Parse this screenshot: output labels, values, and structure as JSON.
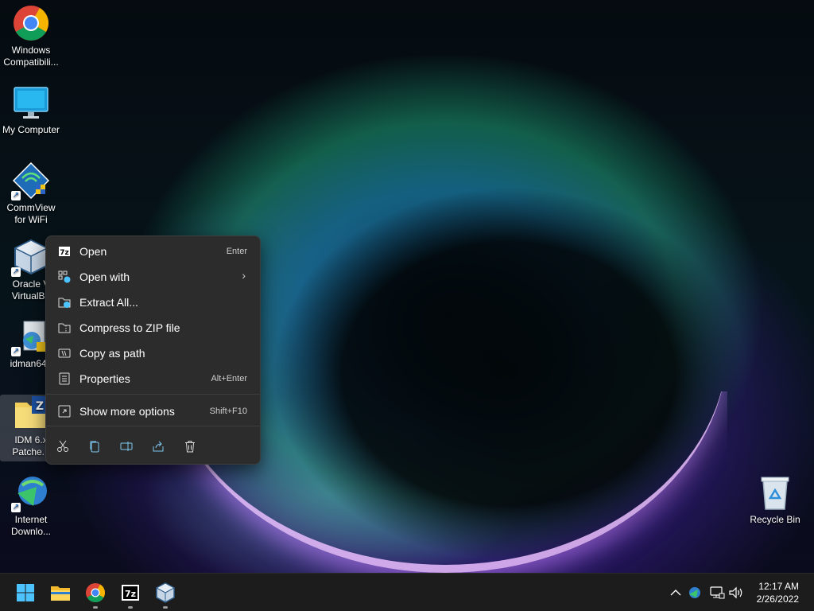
{
  "desktop": {
    "icons": [
      {
        "label": "Windows\nCompatibili..."
      },
      {
        "label": "My Computer"
      },
      {
        "label": "CommView\nfor WiFi"
      },
      {
        "label": "Oracle V\nVirtualBo"
      },
      {
        "label": "idman640"
      },
      {
        "label": "IDM 6.x\nPatche..."
      },
      {
        "label": "Internet\nDownlo..."
      },
      {
        "label": "Recycle Bin"
      }
    ]
  },
  "context_menu": {
    "items": [
      {
        "label": "Open",
        "shortcut": "Enter",
        "icon": "7zip-icon"
      },
      {
        "label": "Open with",
        "shortcut": "",
        "icon": "open-with-icon"
      },
      {
        "label": "Extract All...",
        "shortcut": "",
        "icon": "extract-icon"
      },
      {
        "label": "Compress to ZIP file",
        "shortcut": "",
        "icon": "zip-icon"
      },
      {
        "label": "Copy as path",
        "shortcut": "",
        "icon": "copy-path-icon"
      },
      {
        "label": "Properties",
        "shortcut": "Alt+Enter",
        "icon": "properties-icon"
      }
    ],
    "more": {
      "label": "Show more options",
      "shortcut": "Shift+F10"
    },
    "bottom_actions": [
      "cut-icon",
      "copy-icon",
      "rename-icon",
      "share-icon",
      "delete-icon"
    ]
  },
  "taskbar": {
    "apps": [
      "start-icon",
      "file-explorer-icon",
      "chrome-icon",
      "7zip-icon",
      "virtualbox-icon"
    ],
    "tray": [
      "chevron-up-icon",
      "network-globe-icon",
      "display-icon",
      "volume-icon"
    ],
    "clock": {
      "time": "12:17 AM",
      "date": "2/26/2022"
    }
  },
  "colors": {
    "menu_bg": "#2c2c2c",
    "taskbar_bg": "#1c1c1c",
    "accent": "#4cc2ff"
  }
}
